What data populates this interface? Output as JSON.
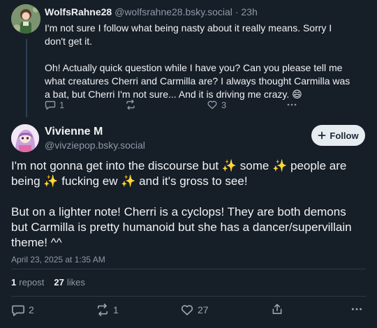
{
  "reply": {
    "author_name": "WolfsRahne28",
    "handle": "@wolfsrahne28.bsky.social",
    "separator": "·",
    "time": "23h",
    "paragraphs": [
      "I'm not sure I follow what being nasty about it really means. Sorry I don't get it.",
      "Oh! Actually quick question while I have you? Can you please tell me what creatures Cherri and Carmilla are? I always thought Carmilla was a bat, but Cherri I'm not sure... And it is driving me crazy. 😄"
    ],
    "reply_count": "1",
    "like_count": "3"
  },
  "post": {
    "author_name": "Vivienne M",
    "handle": "@vivziepop.bsky.social",
    "follow_label": "Follow",
    "line1_a": "I'm not gonna get into the discourse but ",
    "line1_b": " some ",
    "line1_c": " people are being ",
    "line1_d": " fucking ew ",
    "line1_e": " and it's gross to see!",
    "paragraph2": "But on a lighter note! Cherri is a cyclops! They are both demons but Carmilla is pretty humanoid but she has a dancer/supervillain theme! ^^",
    "sparkle": "✨",
    "date": "April 23, 2025 at 1:35 AM",
    "reposts_count": "1",
    "reposts_label": "repost",
    "likes_count": "27",
    "likes_label": "likes",
    "reply_count": "2",
    "repost_count": "1",
    "like_count": "27"
  },
  "colors": {
    "background": "#161e27",
    "text": "#f1f3f5",
    "muted": "#8d9aa8",
    "follow_bg": "#e7ecf1"
  }
}
